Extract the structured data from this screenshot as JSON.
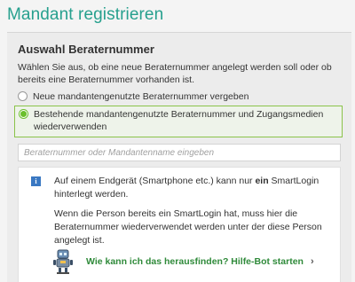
{
  "page": {
    "title": "Mandant registrieren"
  },
  "selection": {
    "heading": "Auswahl Beraternummer",
    "description": "Wählen Sie aus, ob eine neue Beraternummer angelegt werden soll oder ob bereits eine Beraternummer vorhanden ist.",
    "options": [
      {
        "label": "Neue mandantengenutzte Beraternummer vergeben",
        "checked": false
      },
      {
        "label": "Bestehende mandantengenutzte Beraternummer und Zugangsmedien wiederverwenden",
        "checked": true
      }
    ]
  },
  "search": {
    "placeholder": "Beraternummer oder Mandantenname eingeben",
    "value": ""
  },
  "info": {
    "icon": "info-icon",
    "text1_before": "Auf einem Endgerät (Smartphone etc.) kann nur ",
    "text1_bold": "ein",
    "text1_after": " SmartLogin hinterlegt werden.",
    "text2": "Wenn die Person bereits ein SmartLogin hat, muss hier die Beraternummer wiederverwendet werden unter der diese Person angelegt ist.",
    "bot_link": "Wie kann ich das herausfinden? Hilfe-Bot starten",
    "bot_icon": "robot-icon",
    "chevron": "›"
  },
  "colors": {
    "accent_title": "#27a08e",
    "radio_checked": "#6abf2c",
    "link_green": "#2f8a3a",
    "info_blue": "#3a78c2"
  }
}
